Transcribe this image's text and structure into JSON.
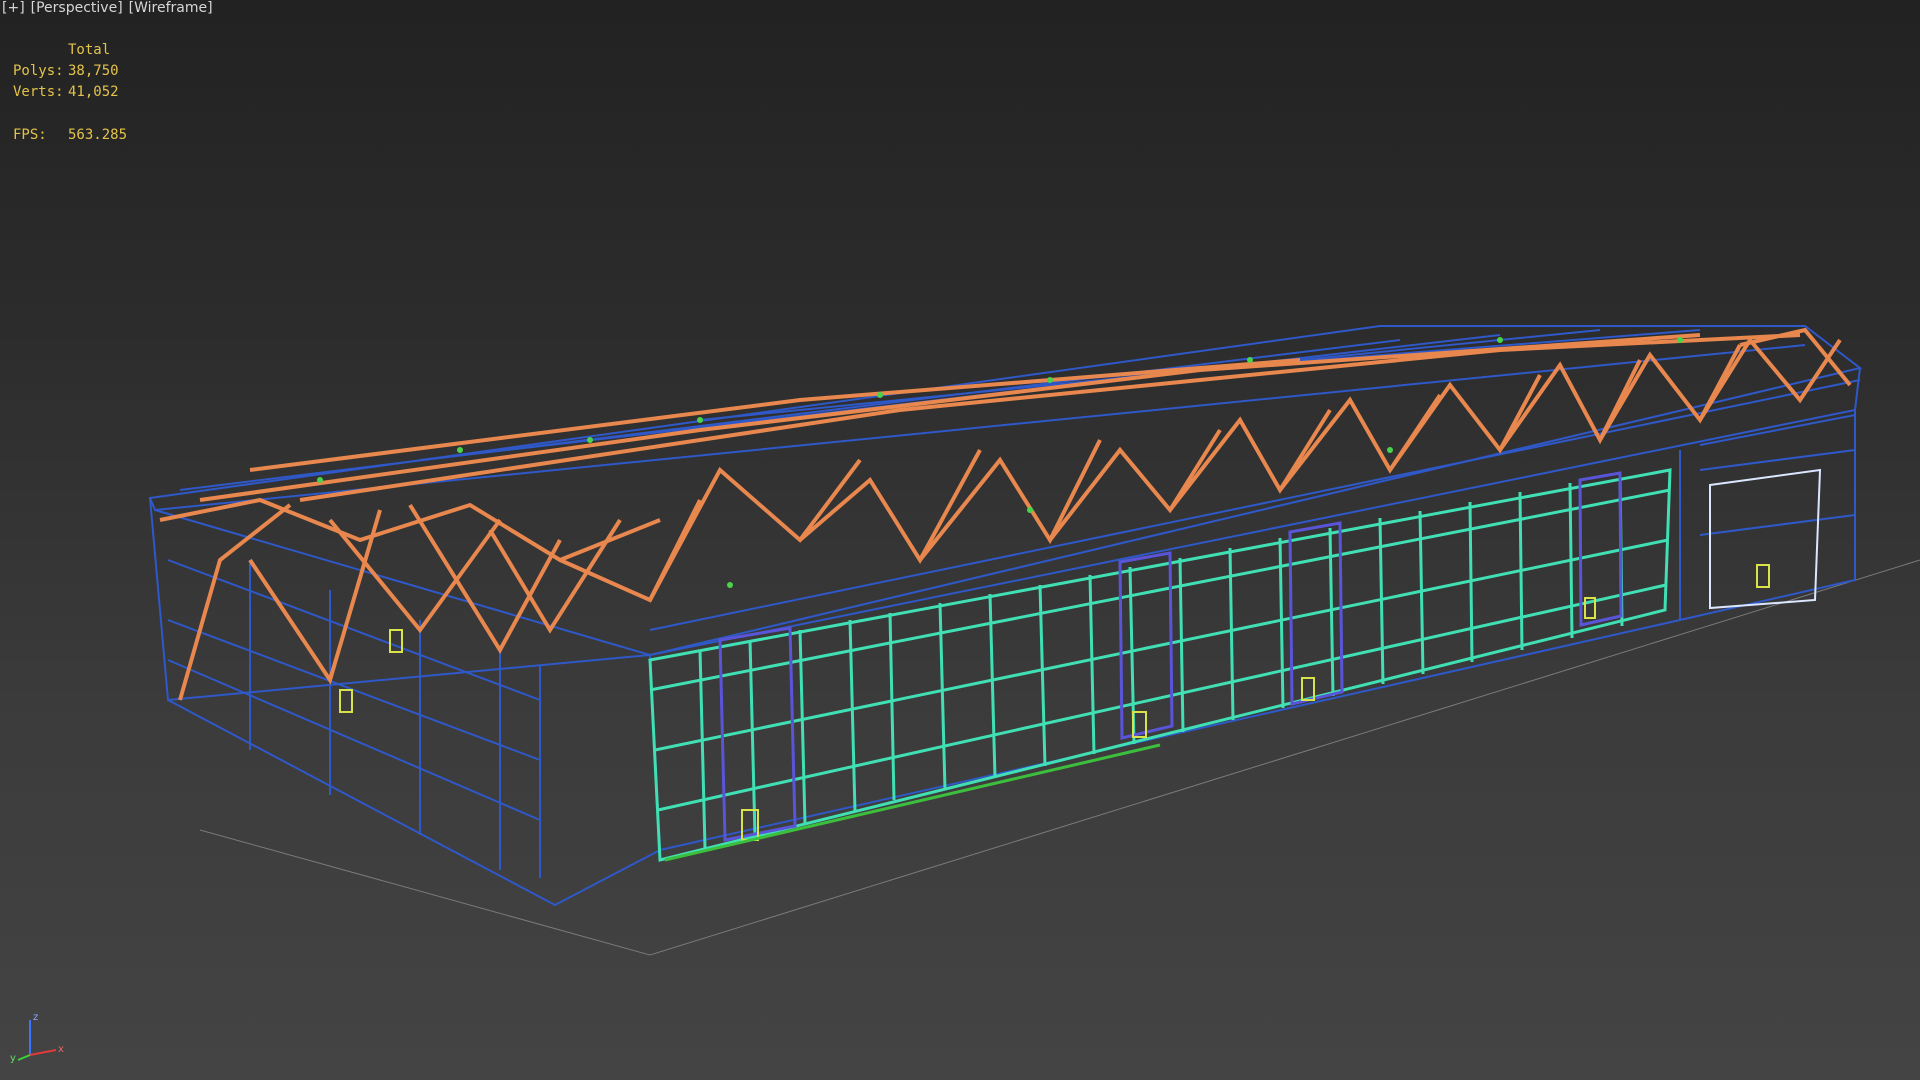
{
  "viewport": {
    "label_plus": "[+]",
    "label_view": "[Perspective]",
    "label_shading": "[Wireframe]"
  },
  "stats": {
    "header": "Total",
    "polys_label": "Polys:",
    "polys_value": "38,750",
    "verts_label": "Verts:",
    "verts_value": "41,052",
    "fps_label": "FPS:",
    "fps_value": "563.285"
  },
  "gizmo": {
    "z": "z",
    "x": "x",
    "y": "y"
  },
  "colors": {
    "trusses": "#e8874e",
    "frame": "#2f58c8",
    "doors": "#40e0b4",
    "door_panels": "#5a55d8",
    "small_doors": "#d8e34a",
    "stats_text": "#e4c34a",
    "viewport_text": "#d6d6d6"
  },
  "icons": [
    "axis-gizmo-icon"
  ]
}
